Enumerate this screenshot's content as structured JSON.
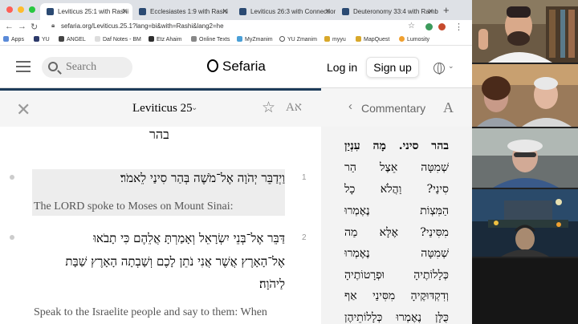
{
  "browser": {
    "tabs": [
      {
        "label": "Leviticus 25:1 with Rashi",
        "active": true
      },
      {
        "label": "Ecclesiastes 1:9 with Rashi",
        "active": false
      },
      {
        "label": "Leviticus 26:3 with Connection",
        "active": false
      },
      {
        "label": "Deuteronomy 33:4 with Ramban",
        "active": false
      }
    ],
    "new_tab": "+",
    "url": "sefaria.org/Leviticus.25.1?lang=bi&with=Rashi&lang2=he",
    "bookmarks": [
      "Apps",
      "YU",
      "ANGEL",
      "Daf Notes - BM",
      "Etz Ahaim",
      "Online Texts",
      "MyZmanim",
      "YU Zmanim",
      "myyu",
      "MapQuest",
      "Lumosity"
    ]
  },
  "header": {
    "search_placeholder": "Search",
    "logo": "Sefaria",
    "login": "Log in",
    "signup": "Sign up"
  },
  "reader": {
    "ref_title": "Leviticus 25",
    "section_title": "בהר",
    "verses": [
      {
        "num": "1",
        "hebrew": [
          "וַיְדַבֵּר יְהֹוָה אֶל־מֹשֶׁה בְּהַר סִינַי לֵאמֹר׃"
        ],
        "english": [
          "The LORD spoke to Moses on Mount Sinai:"
        ]
      },
      {
        "num": "2",
        "hebrew": [
          "דַּבֵּר אֶל־בְּנֵי יִשְׂרָאֵל וְאָמַרְתָּ אֲלֵהֶם כִּי תָבֹאוּ",
          "אֶל־הָאָרֶץ אֲשֶׁר אֲנִי נֹתֵן לָכֶם וְשָׁבְתָה הָאָרֶץ שַׁבָּת",
          "לַיהֹוָה׃"
        ],
        "english": [
          "Speak to the Israelite people and say to them: When"
        ]
      }
    ]
  },
  "commentary": {
    "label": "Commentary",
    "font_button": "A",
    "lines": [
      "בהר סיני. מָה עִנְיַן",
      "שְׁמִטָּה אֵצֶל הַר",
      "סִינַי? וַהֲלֹא כָל",
      "הַמִּצְוֹת נֶאֶמְרוּ",
      "מִסִּינַי? אֶלָּא מַה",
      "שְׁמִטָּה נֶאֶמְרוּ",
      "כְּלָלוֹתֶיהָ וּפְרָטוֹתֶיהָ",
      "וְדִקְדּוּקֶיהָ מִסִּינַי אַף",
      "כֻּלָּן נֶאֶמְרוּ כְּלָלוֹתֵיהֶן"
    ]
  },
  "colors": {
    "accent": "#1e3c5a",
    "reader_bg": "#ffffff",
    "commentary_bg": "#f3f3f3"
  }
}
